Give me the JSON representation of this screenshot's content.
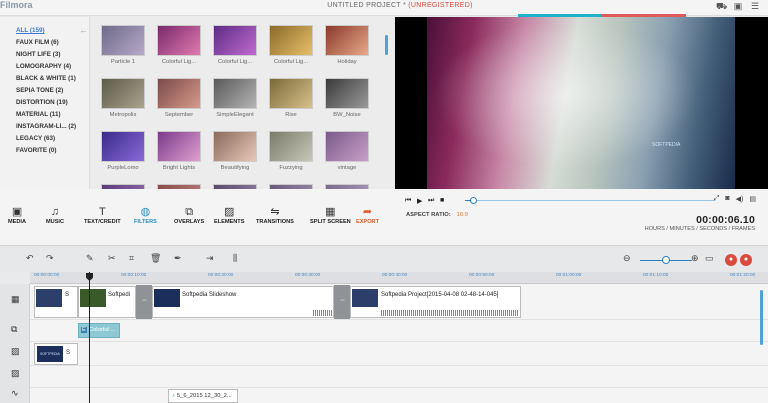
{
  "app": {
    "logo": "Filmora",
    "project_title": "UNTITLED PROJECT *",
    "project_status": "(UNREGISTERED)",
    "accent_colors": [
      "#1fb3c9",
      "#e05a5a"
    ]
  },
  "titlebar_icons": [
    "cart-icon",
    "account-icon",
    "menu-icon"
  ],
  "categories": [
    {
      "label": "ALL (159)",
      "active": true
    },
    {
      "label": "FAUX FILM (6)"
    },
    {
      "label": "NIGHT LIFE (3)"
    },
    {
      "label": "LOMOGRAPHY (4)"
    },
    {
      "label": "BLACK & WHITE (1)"
    },
    {
      "label": "SEPIA TONE (2)"
    },
    {
      "label": "DISTORTION (19)"
    },
    {
      "label": "MATERIAL (11)"
    },
    {
      "label": "INSTAGRAM-LI... (2)"
    },
    {
      "label": "LEGACY (63)"
    },
    {
      "label": "FAVORITE (0)"
    }
  ],
  "filters": [
    {
      "label": "Particle 1",
      "colors": [
        "#6e6a88",
        "#b7a9c9"
      ]
    },
    {
      "label": "Colorful Lig...",
      "colors": [
        "#7a2a6a",
        "#e07ab0"
      ]
    },
    {
      "label": "Colorful Lig...",
      "colors": [
        "#5d2c84",
        "#c06ad0"
      ]
    },
    {
      "label": "Colorful Lig...",
      "colors": [
        "#8a6a2a",
        "#e8c06a"
      ]
    },
    {
      "label": "Holiday",
      "colors": [
        "#8a3a2a",
        "#e8a88a"
      ]
    },
    {
      "label": "Metropolis",
      "colors": [
        "#5e5a4a",
        "#aaa48e"
      ]
    },
    {
      "label": "September",
      "colors": [
        "#7a4a4a",
        "#d89a8a"
      ]
    },
    {
      "label": "SimpleElegant",
      "colors": [
        "#5a5a5a",
        "#b4b4b4"
      ]
    },
    {
      "label": "Rise",
      "colors": [
        "#7a6a3a",
        "#d8c08a"
      ]
    },
    {
      "label": "BW_Noise",
      "colors": [
        "#3a3a3a",
        "#9a9a9a"
      ]
    },
    {
      "label": "PurpleLomo",
      "colors": [
        "#3a2a8a",
        "#8a6ad8"
      ]
    },
    {
      "label": "Bright Lights",
      "colors": [
        "#7a3a8a",
        "#e0a0d0"
      ]
    },
    {
      "label": "Beautifying",
      "colors": [
        "#8a6a5a",
        "#e8c8b8"
      ]
    },
    {
      "label": "Fuzzying",
      "colors": [
        "#7a7a6a",
        "#c8c8b8"
      ]
    },
    {
      "label": "vintage",
      "colors": [
        "#7a5a8a",
        "#c8a0c8"
      ]
    },
    {
      "label": "",
      "colors": [
        "#5a3a7a",
        "#9a7ab8"
      ]
    },
    {
      "label": "",
      "colors": [
        "#8a4a4a",
        "#c88a8a"
      ]
    },
    {
      "label": "",
      "colors": [
        "#5a4a6a",
        "#9a8ab0"
      ]
    },
    {
      "label": "",
      "colors": [
        "#6a5a7a",
        "#a898b8"
      ]
    },
    {
      "label": "",
      "colors": [
        "#7a6a8a",
        "#b8a8c8"
      ]
    }
  ],
  "preview": {
    "watermark": "SOFTPEDIA"
  },
  "player": {
    "aspect_label": "ASPECT RATIO:",
    "aspect_value": "16:9",
    "timecode": "00:00:06.10",
    "timecode_format": "HOURS / MINUTES / SECONDS / FRAMES",
    "progress": 0.03
  },
  "tools": [
    {
      "label": "MEDIA",
      "glyph": "▣",
      "name": "media-tool"
    },
    {
      "label": "MUSIC",
      "glyph": "♫",
      "name": "music-tool"
    },
    {
      "label": "TEXT/CREDIT",
      "glyph": "T",
      "name": "text-credit-tool"
    },
    {
      "label": "FILTERS",
      "glyph": "◍",
      "name": "filters-tool",
      "active": true
    },
    {
      "label": "OVERLAYS",
      "glyph": "⧉",
      "name": "overlays-tool"
    },
    {
      "label": "ELEMENTS",
      "glyph": "▨",
      "name": "elements-tool"
    },
    {
      "label": "TRANSITIONS",
      "glyph": "⇋",
      "name": "transitions-tool"
    },
    {
      "label": "SPLIT SCREEN",
      "glyph": "▦",
      "name": "split-screen-tool"
    },
    {
      "label": "EXPORT",
      "glyph": "➦",
      "name": "export-tool",
      "export": true
    }
  ],
  "ruler_ticks": [
    "00:00:00:00",
    "00:00:10:00",
    "00:00:20:00",
    "00:00:30:00",
    "00:00:40:00",
    "00:00:50:00",
    "00:01:00:00",
    "00:01:10:00",
    "00:01:20:00"
  ],
  "timeline": {
    "clips": [
      {
        "label": "S",
        "thumb": "#2b3f6a"
      },
      {
        "label": "Softpedi",
        "thumb": "#3a5a2a"
      },
      {
        "label": "Softpedia Slideshow",
        "thumb": "#1c2f5c"
      },
      {
        "label": "Softpedia Project[2015-04-08 02-48-14-045]",
        "thumb": "#2b3f6a"
      }
    ],
    "effect": {
      "label": "Colorful ...",
      "badge": "E"
    },
    "pip": {
      "label": "S",
      "thumb_text": "SOFTPEDIA"
    },
    "audio": {
      "label": "5_6_2015 12_30_2..."
    }
  }
}
